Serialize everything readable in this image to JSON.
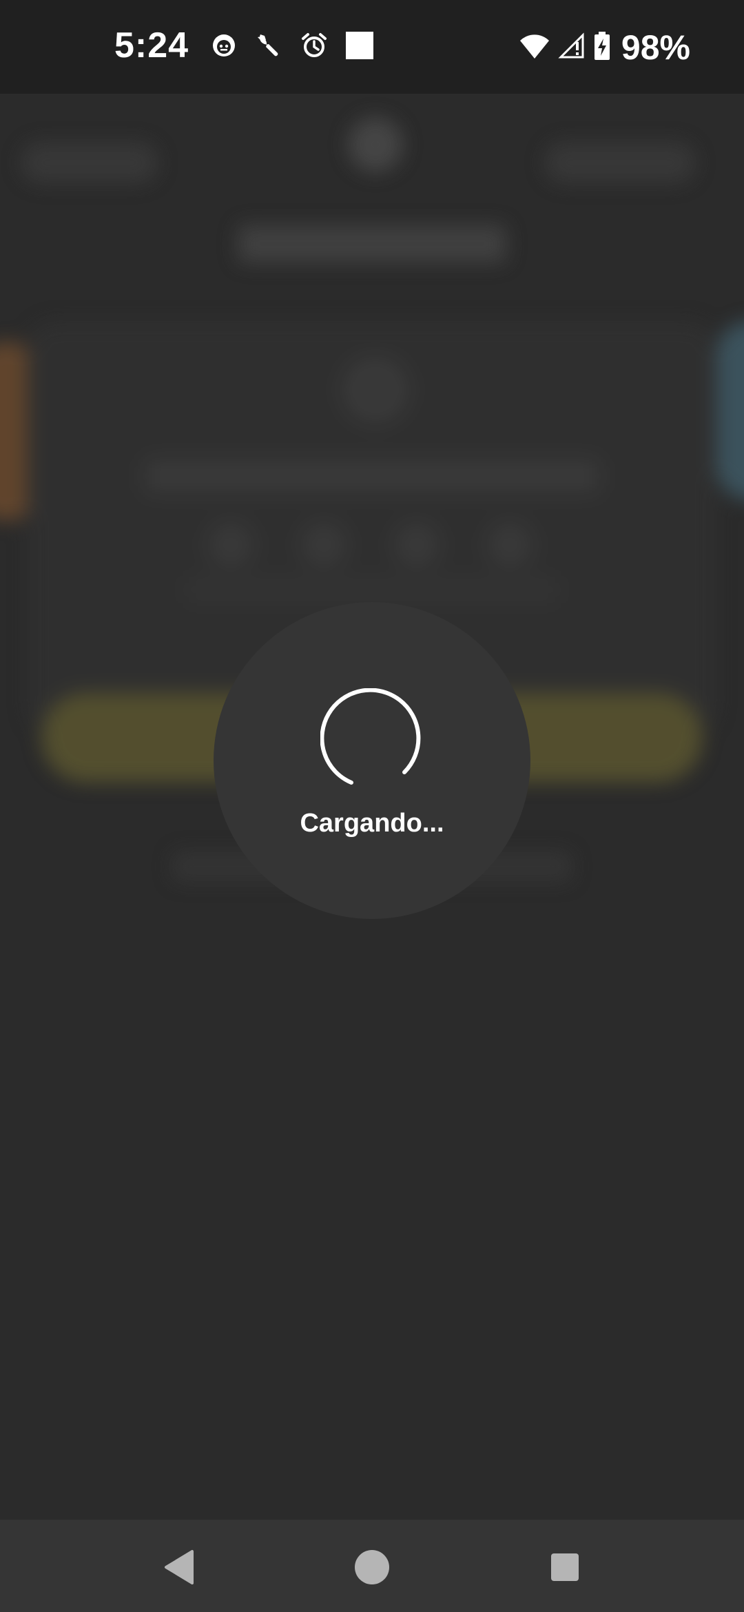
{
  "status_bar": {
    "time": "5:24",
    "icons_left": [
      "face-notification-icon",
      "wrench-icon",
      "alarm-icon",
      "white-square-icon"
    ],
    "icons_right": [
      "wifi-icon",
      "cellular-signal-icon",
      "battery-charging-icon"
    ],
    "battery_text": "98%"
  },
  "loading": {
    "text": "Cargando...",
    "spinner": "circular-progress-icon"
  },
  "nav_bar": {
    "buttons": [
      "back-icon",
      "home-icon",
      "recents-icon"
    ]
  },
  "colors": {
    "background": "#2b2b2b",
    "status_bar": "#202020",
    "dialog": "#353535",
    "nav_bar": "#353535",
    "text": "#ffffff"
  }
}
